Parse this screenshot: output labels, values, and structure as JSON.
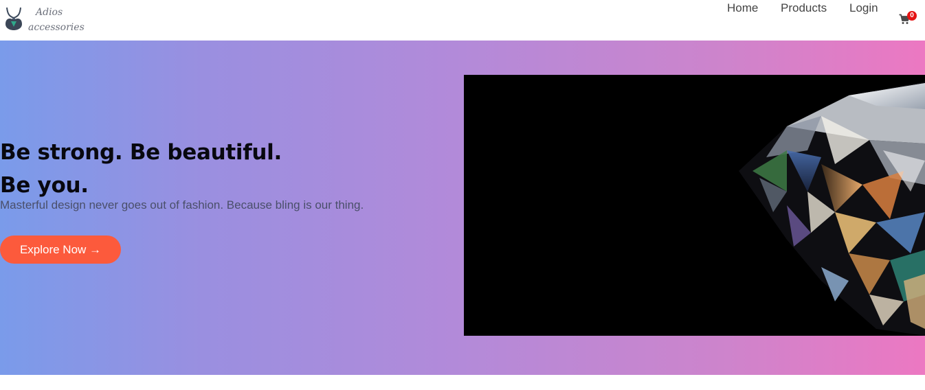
{
  "brand": {
    "logo_line1": "Adios",
    "logo_line2": "accessories",
    "logo_icon": "necklace-icon"
  },
  "nav": {
    "items": [
      {
        "label": "Home"
      },
      {
        "label": "Products"
      },
      {
        "label": "Login"
      }
    ],
    "cart_icon": "shopping-cart-icon",
    "cart_count": "0"
  },
  "hero": {
    "title_line1": "Be strong. Be beautiful.",
    "title_line2": "Be you.",
    "subtitle": "Masterful design never goes out of fashion. Because bling is our thing.",
    "button_label": "Explore Now →",
    "image": "diamond-photo",
    "colors": {
      "gradient_start": "#7a9bea",
      "gradient_end": "#ec78c2",
      "button": "#fc5a3c",
      "badge": "#e51414"
    }
  }
}
